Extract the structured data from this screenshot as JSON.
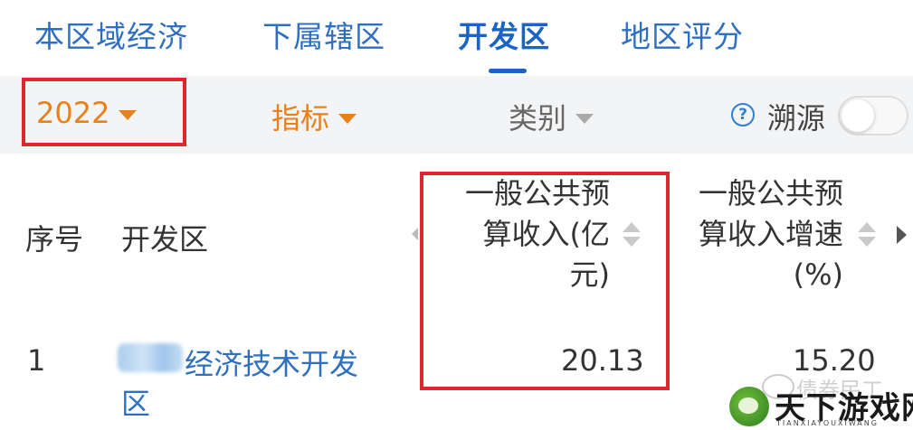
{
  "tabs": [
    {
      "label": "本区域经济"
    },
    {
      "label": "下属辖区"
    },
    {
      "label": "开发区"
    },
    {
      "label": "地区评分"
    }
  ],
  "active_tab": "开发区",
  "filters": {
    "year": "2022",
    "indicator": "指标",
    "category": "类别",
    "source_label": "溯源",
    "source_toggle": "off"
  },
  "table": {
    "headers": {
      "index": "序号",
      "zone": "开发区",
      "revenue": [
        "一般公共预",
        "算收入(亿",
        "元)"
      ],
      "growth": [
        "一般公共预",
        "算收入增速",
        "(%)"
      ]
    },
    "rows": [
      {
        "index": "1",
        "zone_line1": "经济技术开发",
        "zone_line2": "区",
        "revenue": "20.13",
        "growth": "15.20"
      }
    ]
  },
  "watermark": {
    "text": "债券民工",
    "logo_text": "天下游戏网",
    "logo_sub": "TIANXIAYOUXIWANG"
  },
  "colors": {
    "tab_text": "#2f6fc0",
    "active_tab": "#1b63c5",
    "filter_accent": "#e8811c",
    "highlight_border": "#e0262d",
    "link": "#2f6fc0"
  },
  "icons": {
    "year_dropdown": "caret-down-icon",
    "indicator_dropdown": "caret-down-icon",
    "category_dropdown": "caret-down-icon",
    "help": "question-circle-icon",
    "sort": "sort-icon",
    "scroll_right": "chevron-right-icon"
  }
}
